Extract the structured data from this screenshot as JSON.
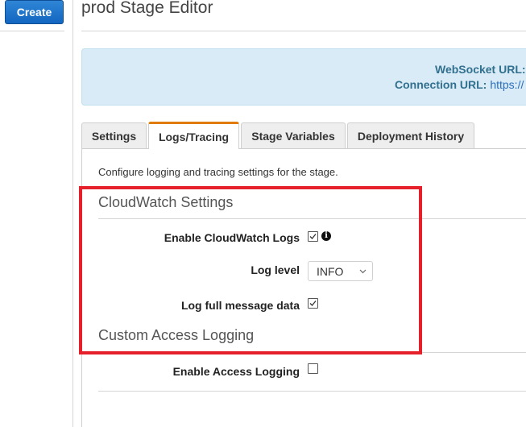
{
  "sidebar": {
    "create_label": "Create"
  },
  "header": {
    "title": "prod Stage Editor"
  },
  "banner": {
    "websocket_label": "WebSocket URL:",
    "connection_label": "Connection URL:",
    "connection_value": "https://"
  },
  "tabs": [
    {
      "label": "Settings",
      "active": false
    },
    {
      "label": "Logs/Tracing",
      "active": true
    },
    {
      "label": "Stage Variables",
      "active": false
    },
    {
      "label": "Deployment History",
      "active": false
    }
  ],
  "panel": {
    "description": "Configure logging and tracing settings for the stage.",
    "cloudwatch": {
      "heading": "CloudWatch Settings",
      "enable_logs_label": "Enable CloudWatch Logs",
      "enable_logs_checked": true,
      "log_level_label": "Log level",
      "log_level_value": "INFO",
      "full_message_label": "Log full message data",
      "full_message_checked": true
    },
    "access_logging": {
      "heading": "Custom Access Logging",
      "enable_label": "Enable Access Logging",
      "enable_checked": false
    }
  },
  "colors": {
    "primary_button": "#1366c0",
    "active_tab_accent": "#e07b00",
    "banner_bg": "#d9ebf6",
    "highlight": "#e5202a"
  },
  "icons": {
    "info": "info-circle-icon",
    "checkmark": "check-icon",
    "chevron": "chevron-down-icon"
  }
}
